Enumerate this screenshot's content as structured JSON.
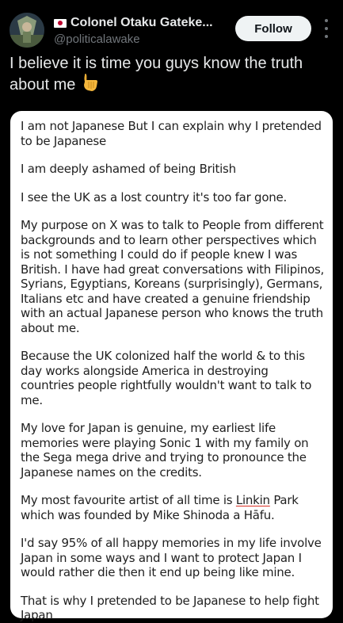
{
  "author": {
    "display_name": "Colonel Otaku Gateke...",
    "handle": "@politicalawake",
    "flag_icon": "japan-flag-icon"
  },
  "actions": {
    "follow_label": "Follow",
    "more_icon": "more-vertical-icon"
  },
  "tweet": {
    "text": "I believe it is time you guys know the truth about me",
    "emoji_icon": "backhand-index-pointing-down-icon"
  },
  "image_text": {
    "p1": "I am not Japanese But I can explain why I pretended to be Japanese",
    "p2": "I am deeply ashamed of being British",
    "p3": "I see the UK as a lost country it's too far gone.",
    "p4": "My purpose on X was to talk to People from different backgrounds and to learn other perspectives which is not something I could do if people knew I was British. I have had great conversations with Filipinos, Syrians, Egyptians, Koreans (surprisingly), Germans, Italians etc and have created a genuine friendship with an actual Japanese person who knows the truth about me.",
    "p5": "Because the UK colonized half the world & to this day works alongside America in destroying countries people rightfully wouldn't want to talk to me.",
    "p6": "My love for Japan is genuine, my earliest life memories were playing Sonic 1 with my family on the Sega mega drive and trying to pronounce the Japanese names on the credits.",
    "p7_before": "My most favourite artist of all time is ",
    "p7_underlined": "Linkin",
    "p7_after": " Park which was founded by Mike Shinoda a Hāfu.",
    "p8": "I'd say 95% of all happy memories in my life involve Japan in some ways and I want to protect Japan I would rather die then it end up being like mine.",
    "p9": "That is why I pretended to be Japanese to help fight Japan"
  }
}
